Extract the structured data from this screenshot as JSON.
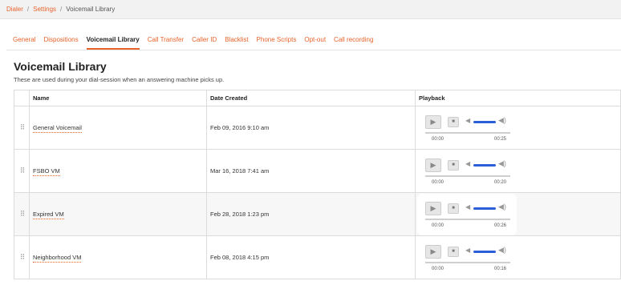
{
  "breadcrumb": {
    "items": [
      "Dialer",
      "Settings"
    ],
    "current": "Voicemail Library"
  },
  "tabs": [
    {
      "label": "General"
    },
    {
      "label": "Dispositions"
    },
    {
      "label": "Voicemail Library"
    },
    {
      "label": "Call Transfer"
    },
    {
      "label": "Caller ID"
    },
    {
      "label": "Blacklist"
    },
    {
      "label": "Phone Scripts"
    },
    {
      "label": "Opt-out"
    },
    {
      "label": "Call recording"
    }
  ],
  "active_tab": "Voicemail Library",
  "page": {
    "title": "Voicemail Library",
    "subtitle": "These are used during your dial-session when an answering machine picks up."
  },
  "table": {
    "headers": {
      "name": "Name",
      "date": "Date Created",
      "playback": "Playback"
    },
    "rows": [
      {
        "name": "General Voicemail",
        "date": "Feb 09, 2016 9:10 am",
        "time_start": "00:00",
        "time_end": "00:25"
      },
      {
        "name": "FSBO VM",
        "date": "Mar 16, 2018 7:41 am",
        "time_start": "00:00",
        "time_end": "00:20"
      },
      {
        "name": "Expired VM",
        "date": "Feb 28, 2018 1:23 pm",
        "time_start": "00:00",
        "time_end": "00:26"
      },
      {
        "name": "Neighborhood VM",
        "date": "Feb 08, 2018 4:15 pm",
        "time_start": "00:00",
        "time_end": "00:16"
      }
    ]
  },
  "icons": {
    "drag": "drag-handle-icon",
    "play": "play-icon",
    "stop": "stop-icon",
    "volume_low": "volume-low-icon",
    "volume_high": "volume-high-icon"
  },
  "colors": {
    "accent": "#e8622a",
    "volume": "#2b5fd9"
  }
}
